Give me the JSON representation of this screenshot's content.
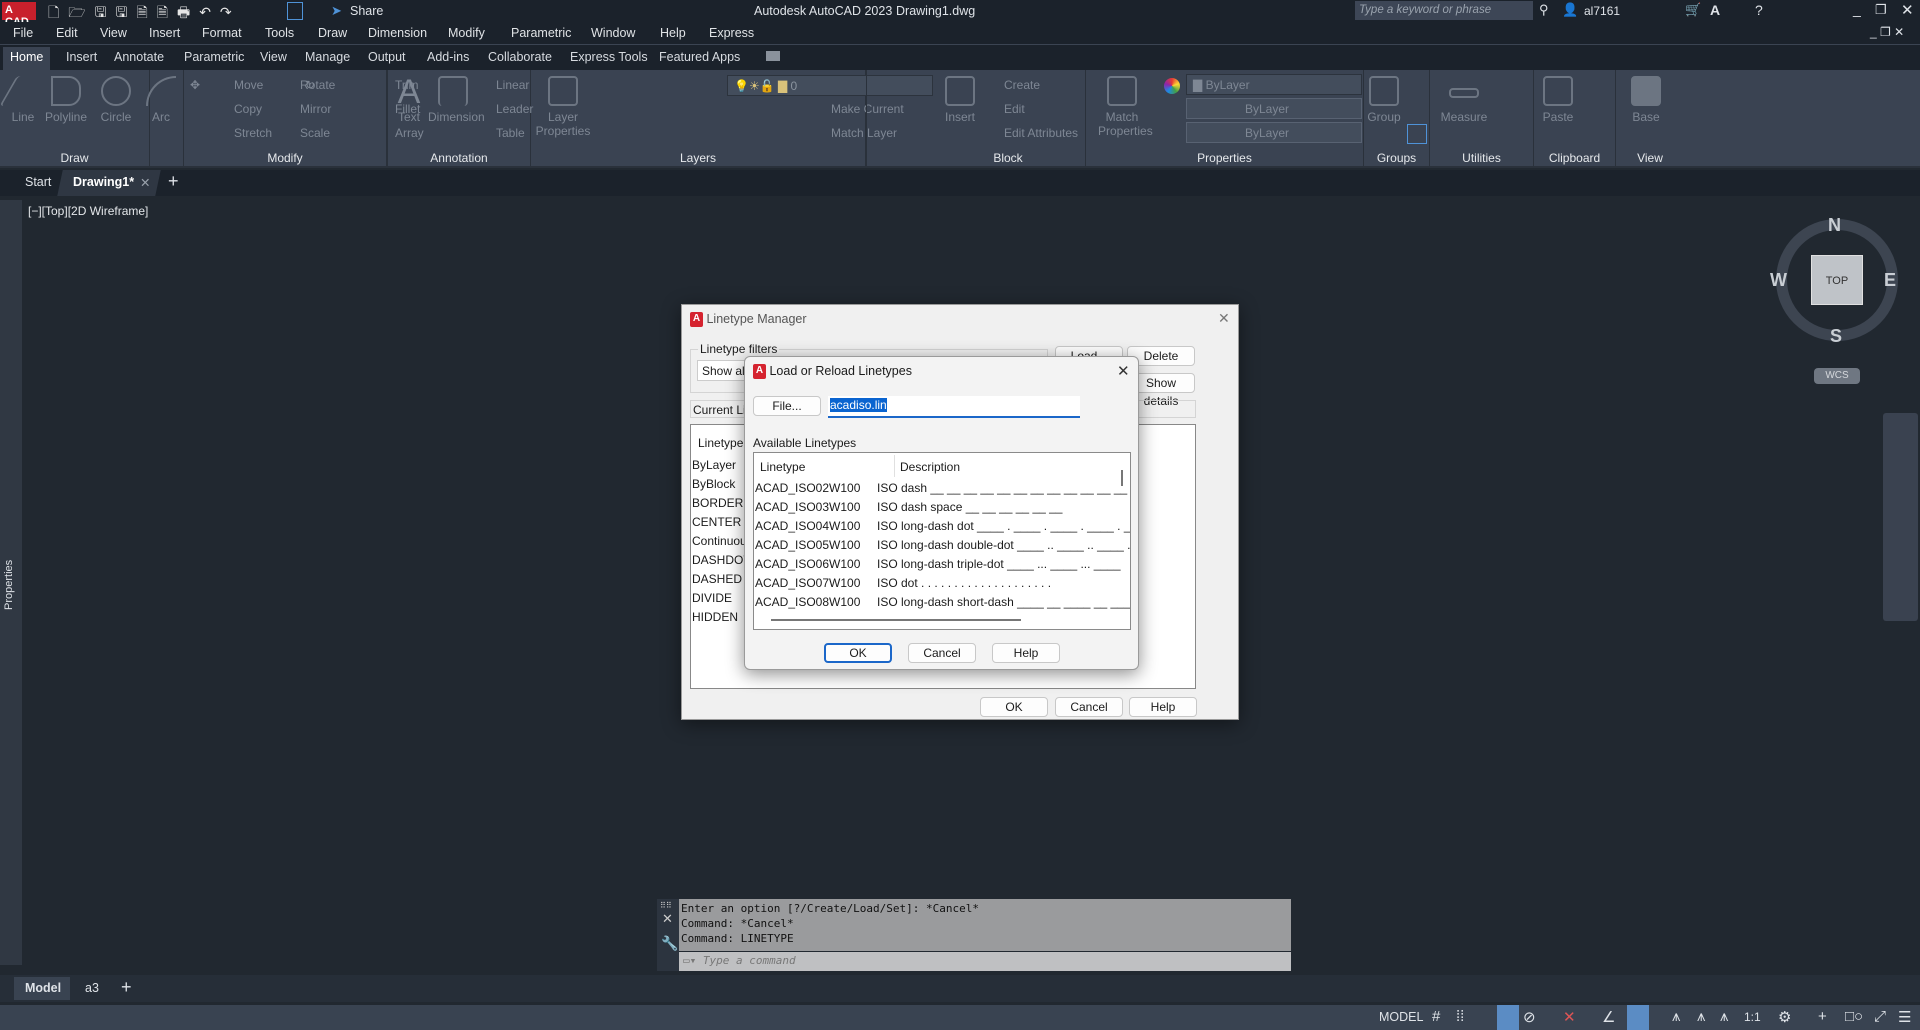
{
  "app": {
    "logo": "A CAD",
    "title": "Autodesk AutoCAD 2023",
    "document": "Drawing1.dwg",
    "share": "Share",
    "search_placeholder": "Type a keyword or phrase",
    "user": "al7161"
  },
  "menu": [
    "File",
    "Edit",
    "View",
    "Insert",
    "Format",
    "Tools",
    "Draw",
    "Dimension",
    "Modify",
    "Parametric",
    "Window",
    "Help",
    "Express"
  ],
  "ribbon_tabs": [
    "Home",
    "Insert",
    "Annotate",
    "Parametric",
    "View",
    "Manage",
    "Output",
    "Add-ins",
    "Collaborate",
    "Express Tools",
    "Featured Apps"
  ],
  "ribbon": {
    "draw": {
      "label": "Draw",
      "items": [
        "Line",
        "Polyline",
        "Circle",
        "Arc"
      ]
    },
    "modify": {
      "label": "Modify",
      "items": [
        "Move",
        "Rotate",
        "Trim",
        "Copy",
        "Mirror",
        "Fillet",
        "Stretch",
        "Scale",
        "Array"
      ]
    },
    "annotation": {
      "label": "Annotation",
      "items": [
        "Text",
        "Dimension",
        "Linear",
        "Leader",
        "Table"
      ]
    },
    "layers": {
      "label": "Layers",
      "layer_props": "Layer Properties",
      "current_layer": "0",
      "make_current": "Make Current",
      "match_layer": "Match Layer"
    },
    "block": {
      "label": "Block",
      "insert": "Insert",
      "items": [
        "Create",
        "Edit",
        "Edit Attributes"
      ]
    },
    "properties": {
      "label": "Properties",
      "match": "Match Properties",
      "color": "ByLayer",
      "lineweight": "ByLayer",
      "linetype": "ByLayer"
    },
    "groups": {
      "label": "Groups",
      "group": "Group"
    },
    "utilities": {
      "label": "Utilities",
      "measure": "Measure"
    },
    "clipboard": {
      "label": "Clipboard",
      "paste": "Paste"
    },
    "view": {
      "label": "View",
      "base": "Base"
    }
  },
  "doc_tabs": {
    "start": "Start",
    "active": "Drawing1*"
  },
  "viewport_label": "[−][Top][2D Wireframe]",
  "viewcube": {
    "n": "N",
    "s": "S",
    "e": "E",
    "w": "W",
    "face": "TOP",
    "ucs": "WCS"
  },
  "palette_label": "Properties",
  "linetype_manager": {
    "title": "Linetype Manager",
    "filters_label": "Linetype filters",
    "filter_value": "Show all li",
    "load": "Load...",
    "delete": "Delete",
    "show_details": "Show details",
    "current_label": "Current Linet",
    "col_linetype": "Linetype",
    "items": [
      "ByLayer",
      "ByBlock",
      "BORDER",
      "CENTER",
      "Continuous",
      "DASHDOT",
      "DASHED",
      "DIVIDE",
      "HIDDEN"
    ],
    "ok": "OK",
    "cancel": "Cancel",
    "help": "Help"
  },
  "load_dialog": {
    "title": "Load or Reload Linetypes",
    "file_button": "File...",
    "file_value": "acadiso.lin",
    "available_label": "Available Linetypes",
    "col_linetype": "Linetype",
    "col_description": "Description",
    "rows": [
      {
        "name": "ACAD_ISO02W100",
        "desc": "ISO dash __ __ __ __ __ __ __ __ __ __ __ __ __"
      },
      {
        "name": "ACAD_ISO03W100",
        "desc": "ISO dash space __    __    __    __    __    __"
      },
      {
        "name": "ACAD_ISO04W100",
        "desc": "ISO long-dash dot ____ . ____ . ____ . ____ . _"
      },
      {
        "name": "ACAD_ISO05W100",
        "desc": "ISO long-dash double-dot ____ .. ____ .. ____ ."
      },
      {
        "name": "ACAD_ISO06W100",
        "desc": "ISO long-dash triple-dot ____ ... ____ ... ____"
      },
      {
        "name": "ACAD_ISO07W100",
        "desc": "ISO dot . . . . . . . . . . . . . . . . . . . ."
      },
      {
        "name": "ACAD_ISO08W100",
        "desc": "ISO long-dash short-dash ____ __ ____ __ ____ ."
      }
    ],
    "ok": "OK",
    "cancel": "Cancel",
    "help": "Help"
  },
  "command_line": {
    "history": [
      "Enter an option [?/Create/Load/Set]: *Cancel*",
      "Command: *Cancel*",
      "Command: LINETYPE"
    ],
    "placeholder": "Type a command"
  },
  "layout_tabs": [
    "Model",
    "a3"
  ],
  "status": {
    "model": "MODEL",
    "scale": "1:1"
  }
}
